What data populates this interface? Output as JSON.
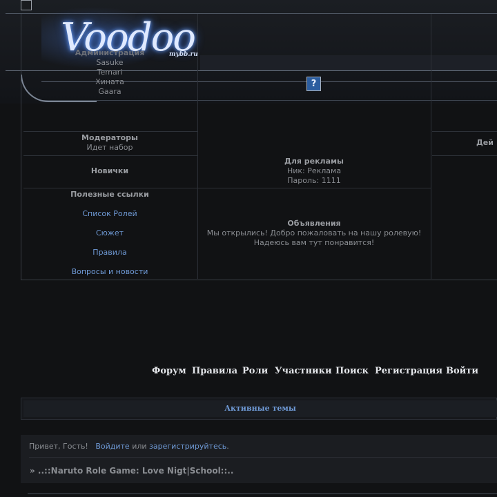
{
  "header": {
    "logo_text": "Voodoo",
    "site_badge": "mybb.ru",
    "help_icon_glyph": "?"
  },
  "info_table": {
    "admins": {
      "title": "Администрация",
      "names": [
        "Sasuke",
        "Temari",
        "Хината",
        "Gaara"
      ]
    },
    "moderators": {
      "title": "Модераторы",
      "value": "Идет набор"
    },
    "newbies": {
      "title": "Новички"
    },
    "useful_links": {
      "title": "Полезные ссылки",
      "items": [
        "Список Ролей",
        "Сюжет",
        "Правила",
        "Вопросы и новости"
      ]
    },
    "ads": {
      "title": "Для рекламы",
      "nick": "Ник: Реклама",
      "password": "Пароль: 1111"
    },
    "announcements": {
      "title": "Объявления",
      "line1": "Мы открылись! Добро пожаловать на нашу ролевую!",
      "line2": "Надеюсь вам тут понравится!"
    },
    "actions_title_partial": "Дей"
  },
  "nav": {
    "items": [
      "Форум",
      "Правила",
      "Роли",
      "Участники",
      "Поиск",
      "Регистрация",
      "Войти"
    ]
  },
  "active_topics": {
    "label": "Активные темы"
  },
  "welcome": {
    "greeting": "Привет, Гость!",
    "login_link": "Войдите",
    "or": "или",
    "register_link": "зарегистрируйтесь",
    "period": ".",
    "forum_title": "» ..::Naruto Role Game: Love Nigt|School::.."
  },
  "colors": {
    "background": "#111214",
    "link": "#6f9ad6",
    "nav_text": "#e4e6ea",
    "help_icon_bg": "#2b5d9f"
  }
}
